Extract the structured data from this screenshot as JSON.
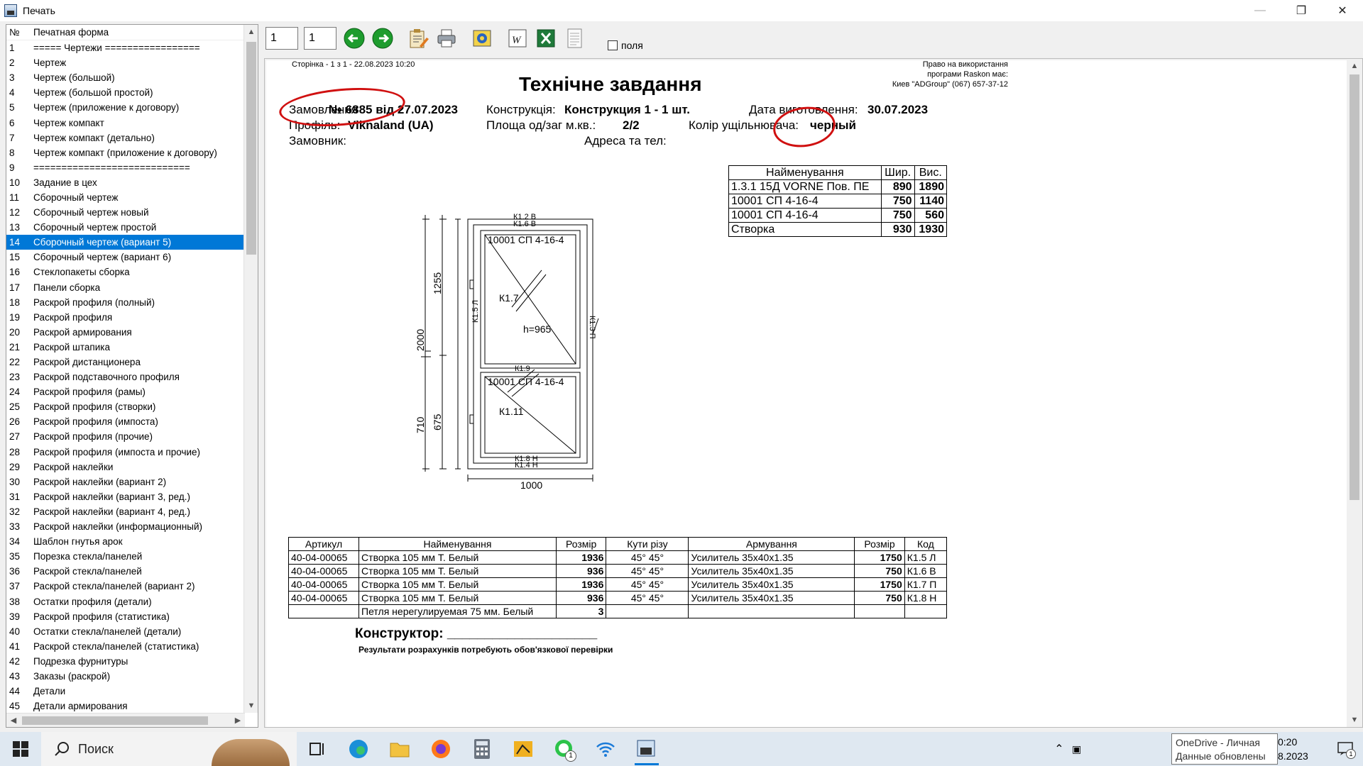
{
  "window": {
    "title": "Печать"
  },
  "list": {
    "headers": {
      "num": "№",
      "name": "Печатная форма"
    },
    "selected": 14,
    "items": [
      {
        "n": "1",
        "t": "===== Чертежи ================="
      },
      {
        "n": "2",
        "t": "Чертеж"
      },
      {
        "n": "3",
        "t": "Чертеж (большой)"
      },
      {
        "n": "4",
        "t": "Чертеж (большой простой)"
      },
      {
        "n": "5",
        "t": "Чертеж (приложение к договору)"
      },
      {
        "n": "6",
        "t": "Чертеж компакт"
      },
      {
        "n": "7",
        "t": "Чертеж компакт (детально)"
      },
      {
        "n": "8",
        "t": "Чертеж компакт (приложение к договору)"
      },
      {
        "n": "9",
        "t": "============================"
      },
      {
        "n": "10",
        "t": "Задание в цех"
      },
      {
        "n": "11",
        "t": "Сборочный чертеж"
      },
      {
        "n": "12",
        "t": "Сборочный чертеж новый"
      },
      {
        "n": "13",
        "t": "Сборочный чертеж простой"
      },
      {
        "n": "14",
        "t": "Сборочный чертеж (вариант 5)"
      },
      {
        "n": "15",
        "t": "Сборочный чертеж (вариант 6)"
      },
      {
        "n": "16",
        "t": "Стеклопакеты сборка"
      },
      {
        "n": "17",
        "t": "Панели сборка"
      },
      {
        "n": "18",
        "t": "Раскрой профиля (полный)"
      },
      {
        "n": "19",
        "t": "Раскрой профиля"
      },
      {
        "n": "20",
        "t": "Раскрой армирования"
      },
      {
        "n": "21",
        "t": "Раскрой штапика"
      },
      {
        "n": "22",
        "t": "Раскрой дистанционера"
      },
      {
        "n": "23",
        "t": "Раскрой подставочного профиля"
      },
      {
        "n": "24",
        "t": "Раскрой профиля (рамы)"
      },
      {
        "n": "25",
        "t": "Раскрой профиля (створки)"
      },
      {
        "n": "26",
        "t": "Раскрой профиля (импоста)"
      },
      {
        "n": "27",
        "t": "Раскрой профиля (прочие)"
      },
      {
        "n": "28",
        "t": "Раскрой профиля (импоста и прочие)"
      },
      {
        "n": "29",
        "t": "Раскрой наклейки"
      },
      {
        "n": "30",
        "t": "Раскрой наклейки (вариант 2)"
      },
      {
        "n": "31",
        "t": "Раскрой наклейки (вариант 3, ред.)"
      },
      {
        "n": "32",
        "t": "Раскрой наклейки (вариант 4, ред.)"
      },
      {
        "n": "33",
        "t": "Раскрой наклейки (информационный)"
      },
      {
        "n": "34",
        "t": "Шаблон гнутья арок"
      },
      {
        "n": "35",
        "t": "Порезка стекла/панелей"
      },
      {
        "n": "36",
        "t": "Раскрой стекла/панелей"
      },
      {
        "n": "37",
        "t": "Раскрой стекла/панелей (вариант 2)"
      },
      {
        "n": "38",
        "t": "Остатки профиля (детали)"
      },
      {
        "n": "39",
        "t": "Раскрой профиля (статистика)"
      },
      {
        "n": "40",
        "t": "Остатки стекла/панелей (детали)"
      },
      {
        "n": "41",
        "t": "Раскрой стекла/панелей (статистика)"
      },
      {
        "n": "42",
        "t": "Подрезка фурнитуры"
      },
      {
        "n": "43",
        "t": "Заказы (раскрой)"
      },
      {
        "n": "44",
        "t": "Детали"
      },
      {
        "n": "45",
        "t": "Детали армирования"
      }
    ]
  },
  "toolbar": {
    "page_from": "1",
    "page_to": "1",
    "fields_label": "поля"
  },
  "doc": {
    "page_info": "Сторінка - 1 з 1 - 22.08.2023 10:20",
    "rights1": "Право на використання",
    "rights2": "програми Raskon має:",
    "rights3": "Киев  \"ADGroup\"  (067) 657-37-12",
    "title": "Технічне завдання",
    "order_label": "Замовлення",
    "order_value": "№ 6885 від 27.07.2023",
    "construction_label": "Конструкція:",
    "construction_value": "Конструкция 1 - 1 шт.",
    "date_label": "Дата виготовлення:",
    "date_value": "30.07.2023",
    "profile_label": "Профіль:",
    "profile_value": "Viknaland (UA)",
    "area_label": "Площа од/заг м.кв.:",
    "area_value": "2/2",
    "seal_label": "Колір ущільнювача:",
    "seal_value": "черный",
    "customer_label": "Замовник:",
    "address_label": "Адреса та тел:",
    "constructor_label": "Конструктор: ____________________",
    "note": "Результати розрахунків потребують обов'язкової перевірки"
  },
  "drawing": {
    "top1": "К1.2 В",
    "top2": "К1.6 В",
    "glass1": "10001 СП 4-16-4",
    "glass2": "10001 СП 4-16-4",
    "k17": "К1.7",
    "k111": "К1.11",
    "k15": "К1.5 Л",
    "k13": "К1.3 П",
    "k19": "К1.9",
    "bot1": "К1.8 Н",
    "bot2": "К1.4 Н",
    "h": "h=965",
    "dim_h": "2000",
    "dim_top": "1255",
    "dim_b1": "710",
    "dim_b2": "675",
    "dim_w": "1000"
  },
  "spec_table": {
    "headers": [
      "Найменування",
      "Шир.",
      "Вис."
    ],
    "rows": [
      [
        "1.3.1  15Д VORNE  Пов. ПЕ",
        "890",
        "1890"
      ],
      [
        "10001 СП 4-16-4",
        "750",
        "1140"
      ],
      [
        "10001 СП 4-16-4",
        "750",
        "560"
      ],
      [
        "Створка",
        "930",
        "1930"
      ]
    ]
  },
  "parts_table": {
    "headers": [
      "Артикул",
      "Найменування",
      "Розмір",
      "Кути різу",
      "Армування",
      "Розмір",
      "Код"
    ],
    "rows": [
      [
        "40-04-00065",
        "Створка 105 мм Т. Белый",
        "1936",
        "45°  45°",
        "Усилитель 35х40х1.35",
        "1750",
        "К1.5 Л"
      ],
      [
        "40-04-00065",
        "Створка 105 мм Т. Белый",
        "936",
        "45°  45°",
        "Усилитель 35х40х1.35",
        "750",
        "К1.6 В"
      ],
      [
        "40-04-00065",
        "Створка 105 мм Т. Белый",
        "1936",
        "45°  45°",
        "Усилитель 35х40х1.35",
        "1750",
        "К1.7 П"
      ],
      [
        "40-04-00065",
        "Створка 105 мм Т. Белый",
        "936",
        "45°  45°",
        "Усилитель 35х40х1.35",
        "750",
        "К1.8 Н"
      ],
      [
        "",
        "Петля нерегулируемая 75 мм. Белый",
        "3",
        "",
        "",
        "",
        ""
      ]
    ]
  },
  "taskbar": {
    "search": "Поиск",
    "whatsapp_badge": "1",
    "onedrive1": "OneDrive - Личная",
    "onedrive2": "Данные обновлены",
    "time": "0:20",
    "date": "8.2023",
    "notif_badge": "1"
  }
}
